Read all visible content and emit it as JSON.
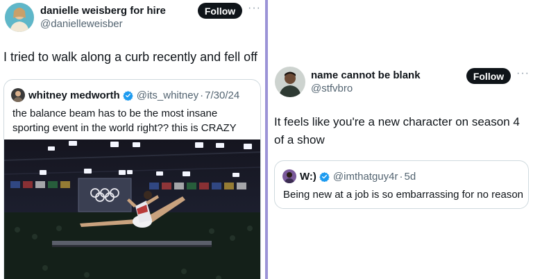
{
  "left": {
    "author": {
      "name": "danielle weisberg for hire",
      "handle": "@danielleweisber"
    },
    "follow_label": "Follow",
    "more_label": "···",
    "text": "I tried to walk along a curb recently and fell off",
    "quote": {
      "name": "whitney medworth",
      "handle": "@its_whitney",
      "separator": "·",
      "date": "7/30/24",
      "text_line1": "the balance beam has to be the most insane",
      "text_line2": "sporting event in the world right?? this is CRAZY",
      "image_icon": "gymnast-balance-beam-photo"
    }
  },
  "right": {
    "author": {
      "name": "name cannot be blank",
      "handle": "@stfvbro"
    },
    "follow_label": "Follow",
    "more_label": "···",
    "text_line1": "It feels like you're a new character on season 4",
    "text_line2": "of a show",
    "quote": {
      "name": "W:)",
      "handle": "@imthatguy4r",
      "separator": "·",
      "date": "5d",
      "text": "Being new at a job is so embarrassing for no reason"
    }
  },
  "colors": {
    "verified": "#1d9bf0",
    "divider": "#9b93d6",
    "follow_bg": "#0f1419",
    "muted": "#536471"
  }
}
